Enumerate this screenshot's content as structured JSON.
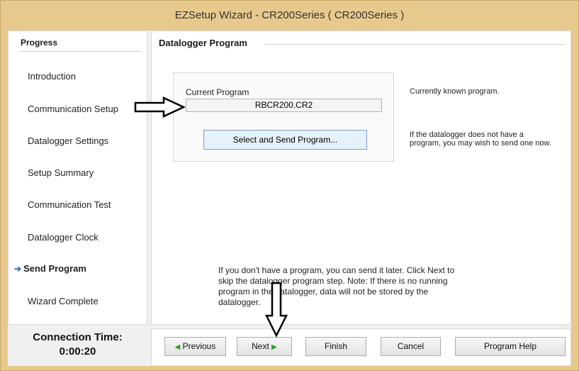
{
  "window": {
    "title": "EZSetup Wizard - CR200Series ( CR200Series )"
  },
  "progress": {
    "title": "Progress",
    "steps": [
      {
        "label": "Introduction"
      },
      {
        "label": "Communication Setup"
      },
      {
        "label": "Datalogger Settings"
      },
      {
        "label": "Setup Summary"
      },
      {
        "label": "Communication Test"
      },
      {
        "label": "Datalogger Clock"
      },
      {
        "label": "Send Program"
      },
      {
        "label": "Wizard Complete"
      }
    ],
    "active_step": "Send Program",
    "active_icon": "arrow-right-icon"
  },
  "connection": {
    "label": "Connection Time:",
    "value": "0:00:20"
  },
  "main": {
    "title": "Datalogger Program",
    "current_program_label": "Current Program",
    "current_program_value": "RBCR200.CR2",
    "current_program_desc": "Currently known program.",
    "send_button": "Select and Send Program...",
    "send_desc": "If the datalogger does not have a program, you may wish to send one now.",
    "info": "If you don't have a program, you can send it later.  Click Next to skip the datalogger program step.  Note: If there is no running program in the datalogger, data will not be stored by the datalogger."
  },
  "buttons": {
    "previous": "Previous",
    "next": "Next",
    "finish": "Finish",
    "cancel": "Cancel",
    "help": "Program Help"
  },
  "colors": {
    "frame": "#e8c98d",
    "active_arrow": "#2a6fc9",
    "nav_triangle": "#2e9a2e",
    "send_button_bg": "#e5f1fb"
  }
}
